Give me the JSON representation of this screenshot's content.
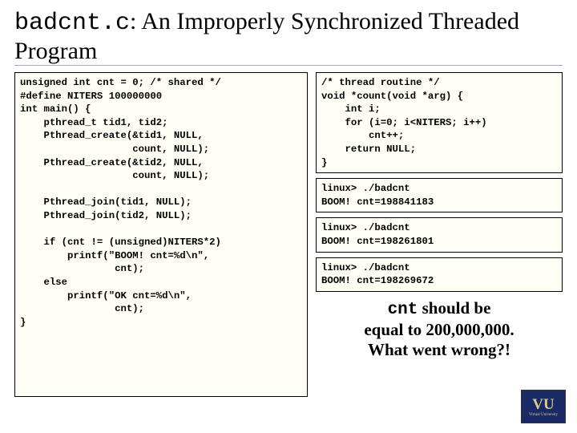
{
  "title": {
    "mono": "badcnt.c",
    "rest": ": An Improperly Synchronized Threaded Program"
  },
  "main_code": "unsigned int cnt = 0; /* shared */\n#define NITERS 100000000\nint main() {\n    pthread_t tid1, tid2;\n    Pthread_create(&tid1, NULL,\n                   count, NULL);\n    Pthread_create(&tid2, NULL,\n                   count, NULL);\n\n    Pthread_join(tid1, NULL);\n    Pthread_join(tid2, NULL);\n\n    if (cnt != (unsigned)NITERS*2)\n        printf(\"BOOM! cnt=%d\\n\",\n                cnt);\n    else\n        printf(\"OK cnt=%d\\n\",\n                cnt);\n}",
  "routine_code": "/* thread routine */\nvoid *count(void *arg) {\n    int i;\n    for (i=0; i<NITERS; i++)\n        cnt++;\n    return NULL;\n}",
  "outputs": [
    "linux> ./badcnt\nBOOM! cnt=198841183",
    "linux> ./badcnt\nBOOM! cnt=198261801",
    "linux> ./badcnt\nBOOM! cnt=198269672"
  ],
  "note": {
    "mono": "cnt",
    "line1_rest": " should be",
    "line2": "equal to 200,000,000.",
    "line3": "What went wrong?!"
  },
  "logo": {
    "main": "VU",
    "sub": "Virtual University"
  }
}
